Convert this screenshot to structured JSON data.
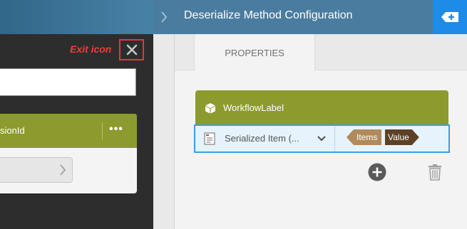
{
  "left_panel": {
    "exit_annotation": "Exit icon",
    "exit_icon": "close-icon",
    "card_title": "sionId",
    "more_label": "•••"
  },
  "right_panel": {
    "title": "Deserialize Method Configuration",
    "header_action_icon": "add-tag-icon",
    "tabs": [
      {
        "label": "PROPERTIES"
      }
    ],
    "workflow": {
      "title": "WorkflowLabel",
      "select_value": "Serialized Item (...",
      "tag_items": "Items",
      "tag_value": "Value"
    },
    "actions": {
      "add_icon": "plus-circle-icon",
      "delete_icon": "trash-icon"
    }
  },
  "colors": {
    "header_blue": "#4a7c9f",
    "accent_blue": "#1f8be8",
    "olive": "#8d9a2e",
    "exit_red": "#e03a3a",
    "selection_blue": "#3d9be6",
    "tag_light": "#b08a5c",
    "tag_dark": "#5c4126"
  }
}
